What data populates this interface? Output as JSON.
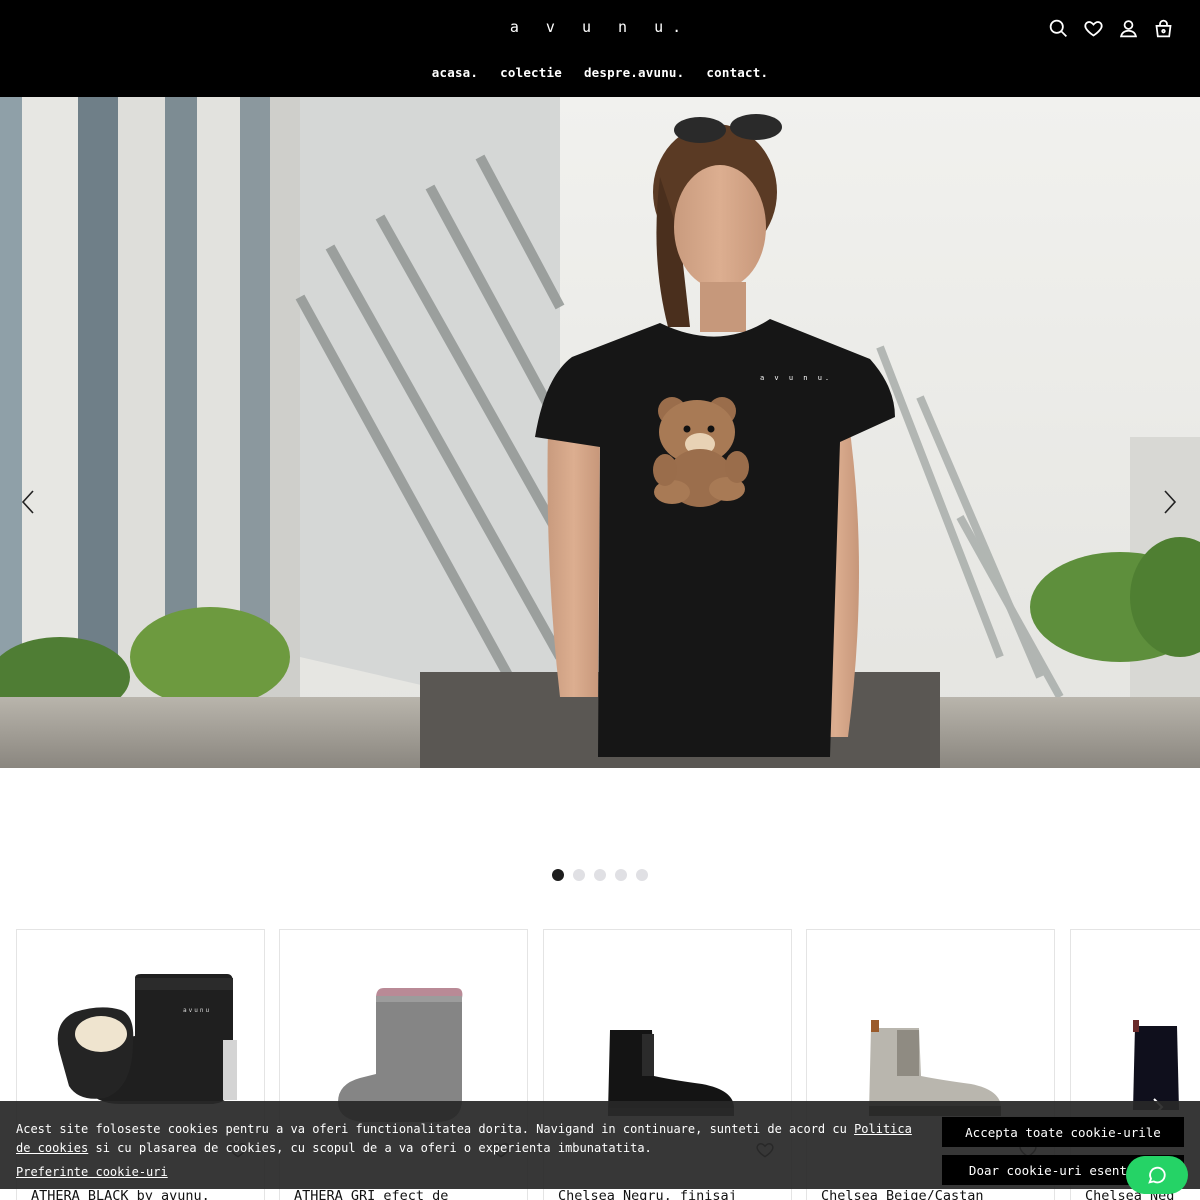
{
  "header": {
    "logo": "a v u n u.",
    "nav": [
      "acasa.",
      "colectie",
      "despre.avunu.",
      "contact."
    ],
    "icons": [
      "search-icon",
      "heart-icon",
      "user-icon",
      "cart-icon"
    ]
  },
  "hero": {
    "shirt_brand": "a v u n u.",
    "slide_count": 5,
    "active_slide": 1
  },
  "products": [
    {
      "title": "ATHERA BLACK by avunu."
    },
    {
      "title": "ATHERA GRI efect de"
    },
    {
      "title": "Chelsea Negru, finisaj"
    },
    {
      "title": "Chelsea Beige/Castan"
    },
    {
      "title": "Chelsea Neg"
    }
  ],
  "cookie": {
    "text_before_link": "Acest site foloseste cookies pentru a va oferi functionalitatea dorita. Navigand in continuare, sunteti de acord cu ",
    "link_text": "Politica de cookies",
    "text_after_link": " si cu plasarea de cookies, cu scopul de a va oferi o experienta imbunatatita.",
    "preferences_label": "Preferinte cookie-uri",
    "accept_all_label": "Accepta toate cookie-urile",
    "essential_label": "Doar cookie-uri esentiale"
  },
  "colors": {
    "header_bg": "#000000",
    "cookie_bg": "#282828",
    "button_bg": "#000000",
    "chat_green": "#25d366"
  }
}
